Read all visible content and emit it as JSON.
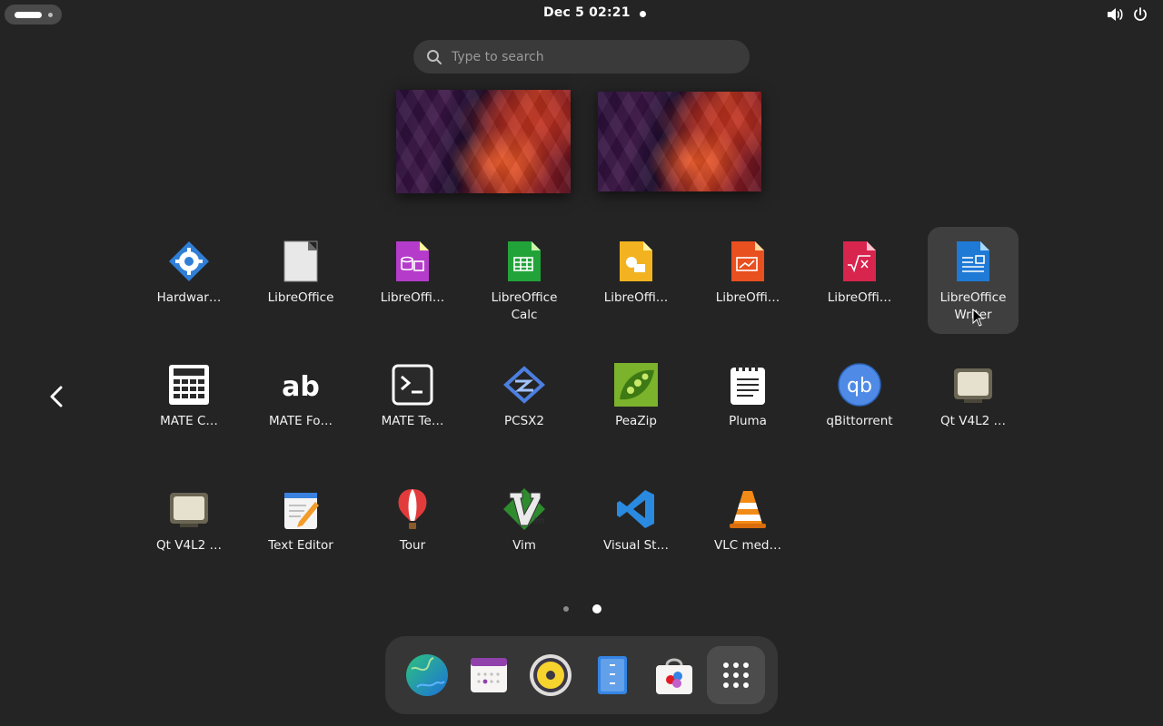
{
  "topbar": {
    "clock": "Dec 5  02:21",
    "icons": [
      "volume-icon",
      "power-icon"
    ]
  },
  "search": {
    "placeholder": "Type to search",
    "value": ""
  },
  "workspaces": [
    "workspace-1",
    "workspace-2"
  ],
  "apps": [
    {
      "label": "Hardwar…",
      "icon": "hardware-gear-icon"
    },
    {
      "label": "LibreOffice",
      "icon": "libreoffice-icon"
    },
    {
      "label": "LibreOffi…",
      "icon": "libreoffice-base-icon"
    },
    {
      "label": "LibreOffice Calc",
      "icon": "libreoffice-calc-icon"
    },
    {
      "label": "LibreOffi…",
      "icon": "libreoffice-draw-icon"
    },
    {
      "label": "LibreOffi…",
      "icon": "libreoffice-impress-icon"
    },
    {
      "label": "LibreOffi…",
      "icon": "libreoffice-math-icon"
    },
    {
      "label": "LibreOffice Writer",
      "icon": "libreoffice-writer-icon",
      "selected": true
    },
    {
      "label": "MATE C…",
      "icon": "calculator-icon"
    },
    {
      "label": "MATE Fo…",
      "icon": "font-viewer-icon"
    },
    {
      "label": "MATE Te…",
      "icon": "terminal-icon"
    },
    {
      "label": "PCSX2",
      "icon": "pcsx2-icon"
    },
    {
      "label": "PeaZip",
      "icon": "peazip-icon"
    },
    {
      "label": "Pluma",
      "icon": "pluma-notepad-icon"
    },
    {
      "label": "qBittorrent",
      "icon": "qbittorrent-icon"
    },
    {
      "label": "Qt V4L2 …",
      "icon": "webcam-icon"
    },
    {
      "label": "Qt V4L2 …",
      "icon": "webcam-icon"
    },
    {
      "label": "Text Editor",
      "icon": "text-editor-icon"
    },
    {
      "label": "Tour",
      "icon": "hot-air-balloon-icon"
    },
    {
      "label": "Vim",
      "icon": "vim-icon"
    },
    {
      "label": "Visual St…",
      "icon": "vscode-icon"
    },
    {
      "label": "VLC med…",
      "icon": "vlc-cone-icon"
    }
  ],
  "pagination": {
    "pages": 2,
    "current": 2
  },
  "dock": [
    {
      "name": "web-browser",
      "icon": "globe-icon"
    },
    {
      "name": "calendar",
      "icon": "calendar-icon"
    },
    {
      "name": "music-player",
      "icon": "speaker-icon"
    },
    {
      "name": "files",
      "icon": "file-manager-icon"
    },
    {
      "name": "software",
      "icon": "software-store-icon"
    },
    {
      "name": "show-apps",
      "icon": "app-grid-icon"
    }
  ],
  "colors": {
    "background": "#242424",
    "selected": "#3f3f3f",
    "dock": "#363636"
  }
}
